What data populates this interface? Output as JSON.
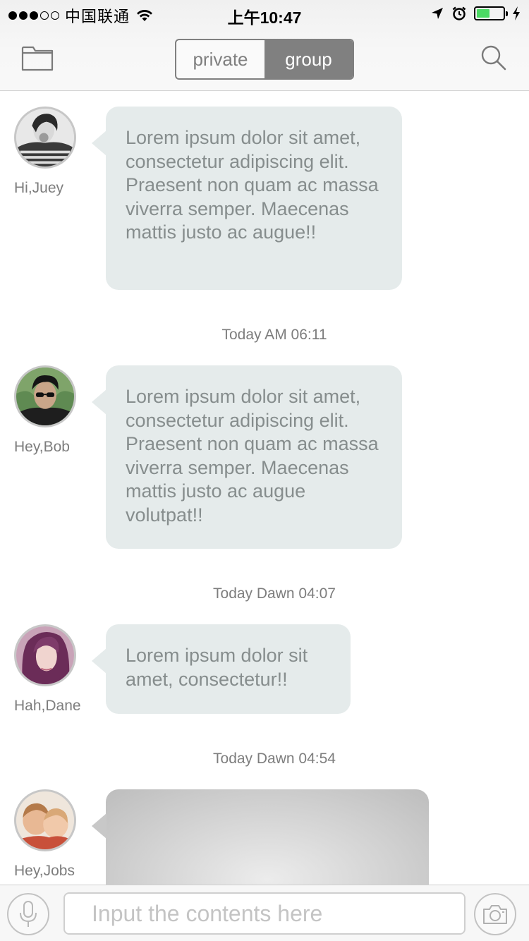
{
  "status_bar": {
    "carrier": "中国联通",
    "time": "上午10:47",
    "signal_strength": 3,
    "signal_max": 5,
    "battery_level": 0.5
  },
  "nav": {
    "folder_icon": "folder-icon",
    "search_icon": "search-icon",
    "segments": [
      {
        "label": "private",
        "active": false
      },
      {
        "label": "group",
        "active": true
      }
    ]
  },
  "messages": [
    {
      "sender": "Hi,Juey",
      "text": "Lorem ipsum dolor sit amet, consectetur adipiscing elit. Praesent non quam ac massa viverra semper. Maecenas mattis justo ac augue!!"
    },
    {
      "sender": "Hey,Bob",
      "text": "Lorem ipsum dolor sit amet, consectetur adipiscing elit. Praesent non quam ac massa viverra semper. Maecenas mattis justo ac augue volutpat!!"
    },
    {
      "sender": "Hah,Dane",
      "text": "Lorem ipsum dolor sit amet, consectetur!!"
    },
    {
      "sender": "Hey,Jobs",
      "text": ""
    }
  ],
  "timestamps": [
    "Today AM 06:11",
    "Today Dawn 04:07",
    "Today Dawn 04:54"
  ],
  "input_bar": {
    "placeholder": "Input the contents here",
    "value": "",
    "mic_icon": "microphone-icon",
    "camera_icon": "camera-icon"
  },
  "colors": {
    "bubble": "#e5ebeb",
    "bubble_text": "#868d8d",
    "segment_active": "#808080",
    "battery": "#4cd964"
  }
}
